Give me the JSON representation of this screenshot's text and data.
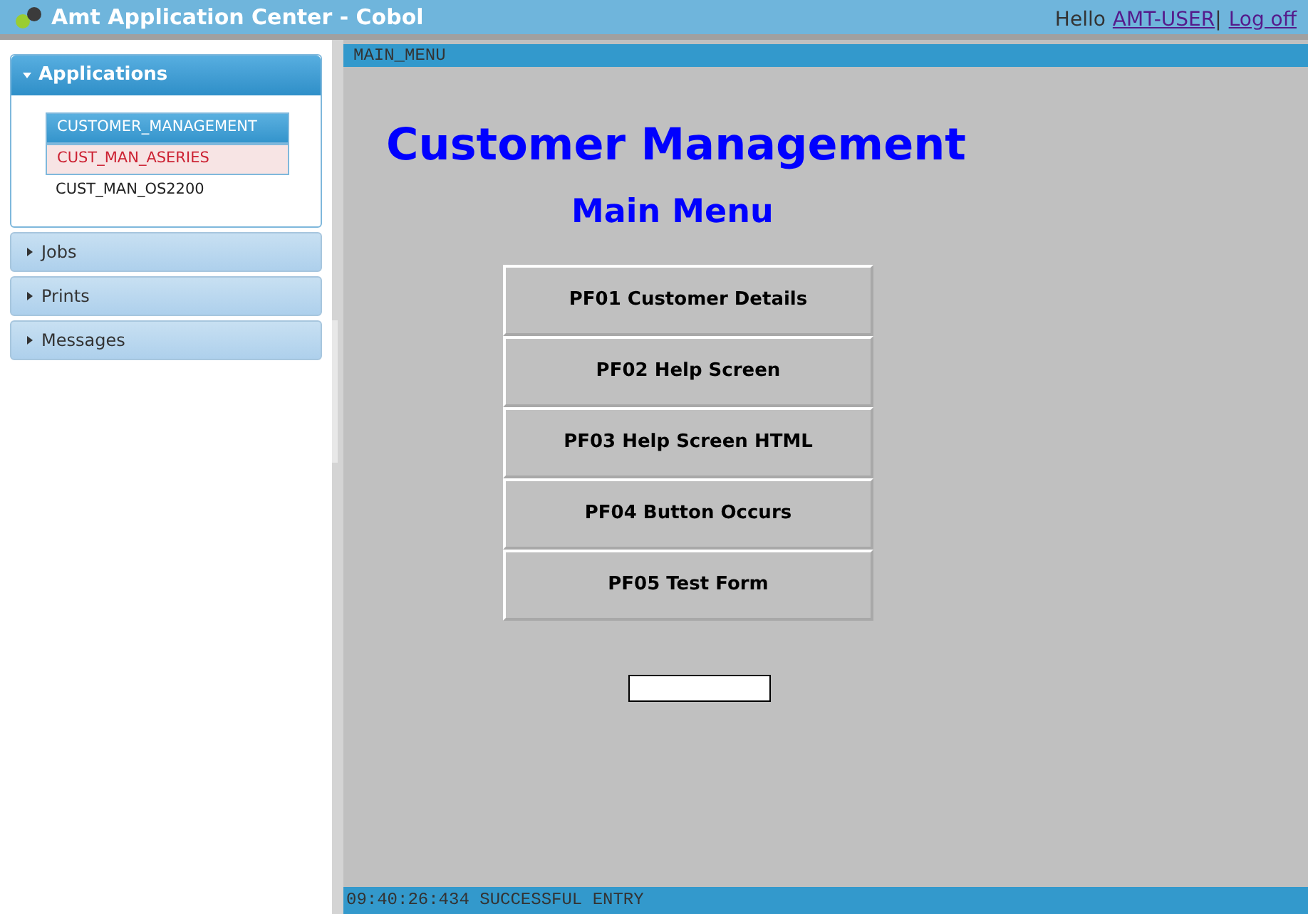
{
  "header": {
    "title": "Amt Application Center - Cobol",
    "greeting": "Hello",
    "user": "AMT-USER",
    "separator": "|",
    "logoff": "Log off"
  },
  "sidebar": {
    "panels": [
      {
        "label": "Applications",
        "expanded": true,
        "items": [
          {
            "label": "CUSTOMER_MANAGEMENT",
            "selected": true,
            "hovered": false
          },
          {
            "label": "CUST_MAN_ASERIES",
            "selected": false,
            "hovered": true
          },
          {
            "label": "CUST_MAN_OS2200",
            "selected": false,
            "hovered": false
          }
        ]
      },
      {
        "label": "Jobs",
        "expanded": false
      },
      {
        "label": "Prints",
        "expanded": false
      },
      {
        "label": "Messages",
        "expanded": false
      }
    ]
  },
  "screen": {
    "name": "MAIN_MENU",
    "title": "Customer Management",
    "subtitle": "Main Menu",
    "buttons": [
      "PF01 Customer Details",
      "PF02 Help Screen",
      "PF03 Help Screen HTML",
      "PF04 Button Occurs",
      "PF05 Test Form"
    ],
    "status": "09:40:26:434 SUCCESSFUL ENTRY"
  }
}
